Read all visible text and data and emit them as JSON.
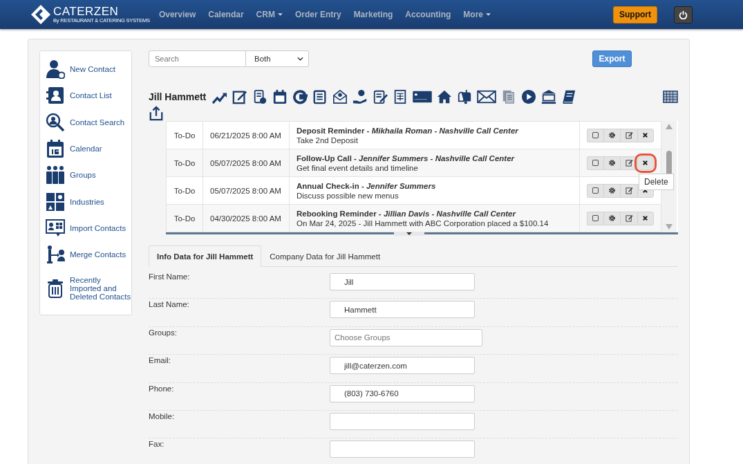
{
  "navbar": {
    "logo": "CATERZEN",
    "logo_tagline": "By RESTAURANT & CATERING SYSTEMS",
    "items": [
      {
        "label": "Overview",
        "dropdown": false
      },
      {
        "label": "Calendar",
        "dropdown": false
      },
      {
        "label": "CRM",
        "dropdown": true
      },
      {
        "label": "Order Entry",
        "dropdown": false
      },
      {
        "label": "Marketing",
        "dropdown": false
      },
      {
        "label": "Accounting",
        "dropdown": false
      },
      {
        "label": "More",
        "dropdown": true
      }
    ],
    "support_button": "Support"
  },
  "sidebar": {
    "items": [
      {
        "label": "New Contact"
      },
      {
        "label": "Contact List"
      },
      {
        "label": "Contact Search"
      },
      {
        "label": "Calendar"
      },
      {
        "label": "Groups"
      },
      {
        "label": "Industries"
      },
      {
        "label": "Import Contacts"
      },
      {
        "label": "Merge Contacts"
      },
      {
        "label": "Recently Imported and Deleted Contacts"
      }
    ]
  },
  "search": {
    "placeholder": "Search",
    "scope": "Both"
  },
  "export_button": "Export",
  "contact_name": "Jill Hammett",
  "activities": [
    {
      "type": "To-Do",
      "datetime": "06/21/2025 8:00 AM",
      "title": "Deposit Reminder - *Mikhaila Roman - Nashville Call Center*",
      "description": "Take 2nd Deposit",
      "delete_highlighted": false
    },
    {
      "type": "To-Do",
      "datetime": "05/07/2025 8:00 AM",
      "title": "Follow-Up Call - *Jennifer Summers - Nashville Call Center*",
      "description": "Get final event details and timeline",
      "delete_highlighted": true
    },
    {
      "type": "To-Do",
      "datetime": "05/07/2025 8:00 AM",
      "title": "Annual Check-in - *Jennifer Summers*",
      "description": "Discuss possible new menus",
      "delete_highlighted": false
    },
    {
      "type": "To-Do",
      "datetime": "04/30/2025 8:00 AM",
      "title": "Rebooking Reminder - *Jillian Davis - Nashville Call Center*",
      "description": "On Mar 24, 2025 - Jill Hammett with ABC Corporation placed a $100.14",
      "delete_highlighted": false
    }
  ],
  "tooltip": "Delete",
  "tabs": [
    {
      "label": "Info Data for Jill Hammett",
      "selected": true
    },
    {
      "label": "Company Data for Jill Hammett",
      "selected": false
    }
  ],
  "fields": [
    {
      "label": "First Name:",
      "value": "Jill"
    },
    {
      "label": "Last Name:",
      "value": "Hammett"
    },
    {
      "label": "Groups:",
      "placeholder": "Choose Groups"
    },
    {
      "label": "Email:",
      "value": "jill@caterzen.com"
    },
    {
      "label": "Phone:",
      "value": "(803) 730-6760"
    },
    {
      "label": "Mobile:"
    },
    {
      "label": "Fax:"
    }
  ]
}
